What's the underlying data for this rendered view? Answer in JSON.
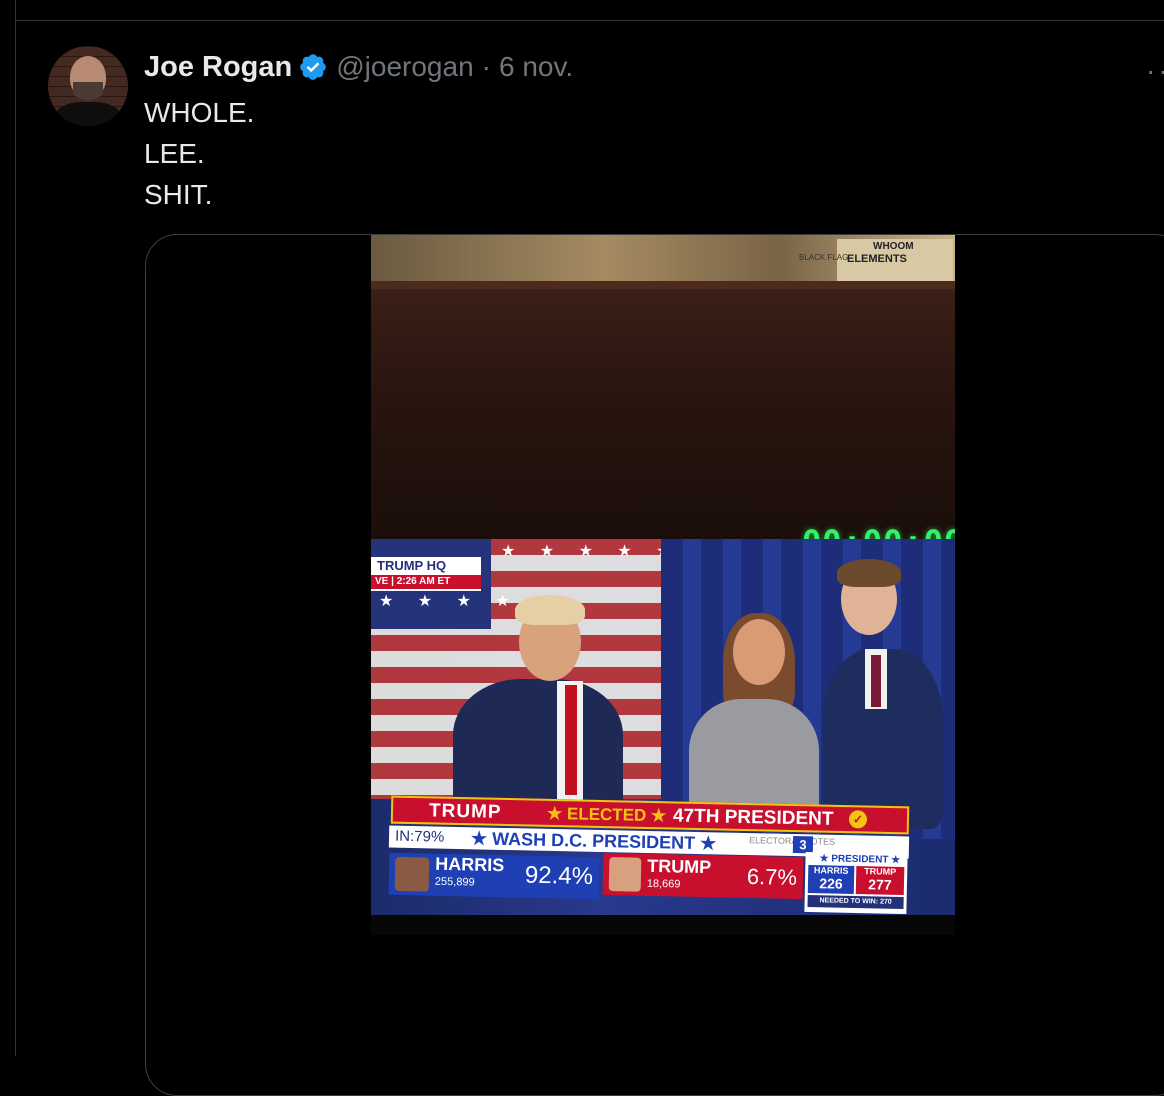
{
  "tweet": {
    "author_name": "Joe Rogan",
    "handle": "@joerogan",
    "separator": "·",
    "timestamp": "6 nov.",
    "more": "··",
    "lines": [
      "WHOLE.",
      "LEE.",
      "SHIT."
    ]
  },
  "media": {
    "timer": "00:00:00",
    "board_top": "WHOOM",
    "board_main": "ELEMENTS",
    "board_side": "BLACK FLAG",
    "broadcast": {
      "location": "TRUMP HQ",
      "live": "VE | 2:26 AM ET",
      "headline_name": "TRUMP",
      "headline_elected": "★ ELECTED ★",
      "headline_title": "47TH PRESIDENT",
      "in_pct": "IN:79%",
      "race": "★ WASH D.C. PRESIDENT ★",
      "electoral_label": "ELECTORAL VOTES",
      "electoral_votes": "3",
      "harris": {
        "name": "HARRIS",
        "votes": "255,899",
        "pct": "92.4%"
      },
      "trump": {
        "name": "TRUMP",
        "votes": "18,669",
        "pct": "6.7%"
      },
      "president_label": "★ PRESIDENT ★",
      "harris_ev_label": "HARRIS",
      "harris_ev": "226",
      "trump_ev_label": "TRUMP",
      "trump_ev": "277",
      "needed": "NEEDED TO WIN: 270"
    }
  },
  "colors": {
    "verified": "#1d9bf0",
    "muted": "#71767b",
    "text": "#e7e9ea"
  }
}
